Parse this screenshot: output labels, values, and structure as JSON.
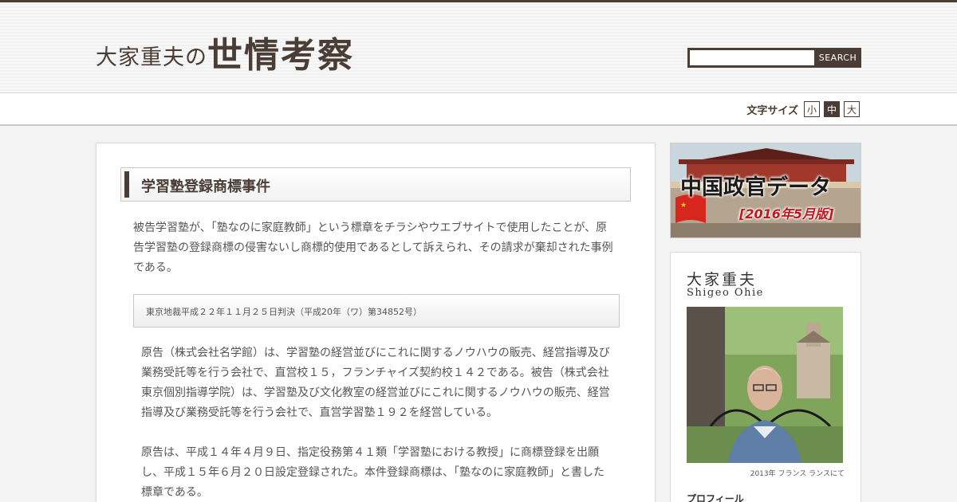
{
  "header": {
    "logo_small": "大家重夫の",
    "logo_big": "世情考察",
    "search_button": "SEARCH"
  },
  "font_size_control": {
    "label": "文字サイズ",
    "options": [
      "小",
      "中",
      "大"
    ],
    "selected": "中"
  },
  "post": {
    "title": "学習塾登録商標事件",
    "lead": "被告学習塾が、「塾なのに家庭教師」という標章をチラシやウエブサイトで使用したことが、原告学習塾の登録商標の侵害ないし商標的使用であるとして訴えられ、その請求が棄却された事例である。",
    "citation": "東京地裁平成２２年１１月２５日判決（平成20年（ワ）第34852号）",
    "paragraphs": [
      "原告（株式会社名学館）は、学習塾の経営並びにこれに関するノウハウの販売、経営指導及び業務受託等を行う会社で、直営校１５，フランチャイズ契約校１４２である。被告（株式会社東京個別指導学院）は、学習塾及び文化教室の経営並びにこれに関するノウハウの販売、経営指導及び業務受託等を行う会社で、直営学習塾１９２を経営している。",
      "原告は、平成１４年４月９日、指定役務第４１類「学習塾における教授」に商標登録を出願し、平成１５年６月２０日設定登録された。本件登録商標は、「塾なのに家庭教師」と書した標章である。"
    ]
  },
  "sidebar": {
    "banner": {
      "title": "中国政官データ",
      "subtitle": "[2016年5月版]"
    },
    "profile": {
      "name": "大家重夫",
      "name_roman": "Shigeo Ohie",
      "photo_caption": "2013年 フランス ランスにて",
      "section_title": "プロフィール"
    }
  },
  "colors": {
    "brand": "#4a3d36",
    "background": "#f3f3f3",
    "banner_accent": "#c4161c"
  }
}
